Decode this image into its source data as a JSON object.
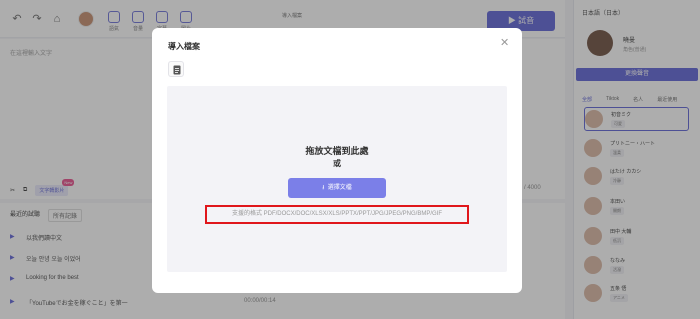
{
  "toolbar": {
    "tools": [
      "語氣",
      "音量",
      "字幕",
      "圖片"
    ],
    "import_label": "導入檔案",
    "preview_label": "試音"
  },
  "editor": {
    "placeholder": "在這裡輸入文字",
    "text_to_speech": "文字轉影片",
    "new_badge": "New",
    "count": "/ 4000"
  },
  "recent": {
    "title": "最近的試聽",
    "all": "所有記錄",
    "rows": [
      "以我們讀中文",
      "오늘 안녕 오늘 이었어",
      "Looking for the best",
      "「YouTubeでお金を稼ぐこと」を第一"
    ],
    "time": "00:00/00:14"
  },
  "right": {
    "language": "日本語（日本）",
    "voice_name": "曉曼",
    "voice_sub": "角色(普通)",
    "change_voice": "更換聲音",
    "filters": [
      "全部",
      "Tiktok",
      "名人",
      "最近使用"
    ],
    "voices": [
      {
        "name": "初音ミク",
        "tag": "可愛"
      },
      {
        "name": "プリトニー・ハート",
        "tag": "溫柔"
      },
      {
        "name": "はたけ カカシ",
        "tag": "冷靜"
      },
      {
        "name": "本田い",
        "tag": "開朗"
      },
      {
        "name": "田中 大輔",
        "tag": "低沉"
      },
      {
        "name": "ななみ",
        "tag": "活潑"
      },
      {
        "name": "五条 悟",
        "tag": "アニメ"
      }
    ]
  },
  "modal": {
    "title": "導入檔案",
    "drop_title": "拖放文檔到此處",
    "or": "或",
    "choose_button": "選擇文檔",
    "formats": "支援的格式 PDF/DOCX/DOC/XLSX/XLS/PPTX/PPT/JPG/JPEG/PNG/BMP/GIF"
  },
  "colors": {
    "accent": "#5b5fd6",
    "highlight": "#e0161b"
  }
}
